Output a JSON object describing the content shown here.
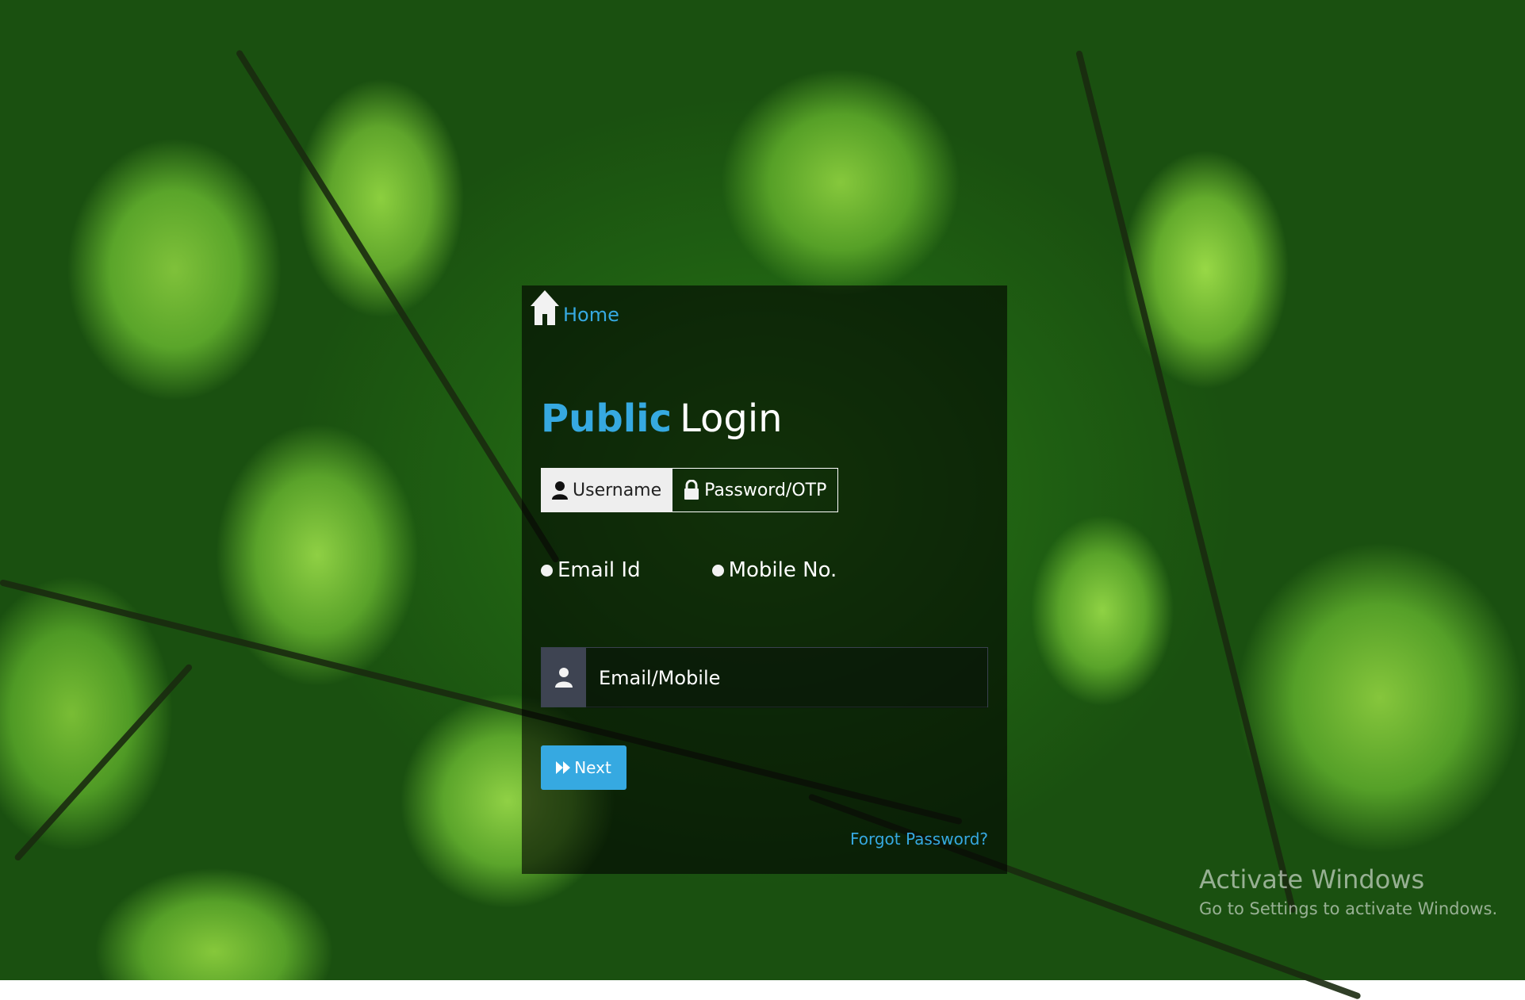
{
  "nav": {
    "home_label": "Home"
  },
  "login": {
    "title_strong": "Public",
    "title_rest": "Login",
    "tabs": [
      {
        "label": "Username",
        "icon": "user-icon",
        "active": true
      },
      {
        "label": "Password/OTP",
        "icon": "lock-icon",
        "active": false
      }
    ],
    "radio_options": [
      {
        "label": "Email Id"
      },
      {
        "label": "Mobile No."
      }
    ],
    "input": {
      "placeholder": "Email/Mobile",
      "value": ""
    },
    "next_label": "Next",
    "forgot_label": "Forgot Password?"
  },
  "watermark": {
    "title": "Activate Windows",
    "subtitle": "Go to Settings to activate Windows."
  },
  "colors": {
    "accent": "#36a9e1",
    "panel_bg": "rgba(0,0,0,0.6)"
  }
}
